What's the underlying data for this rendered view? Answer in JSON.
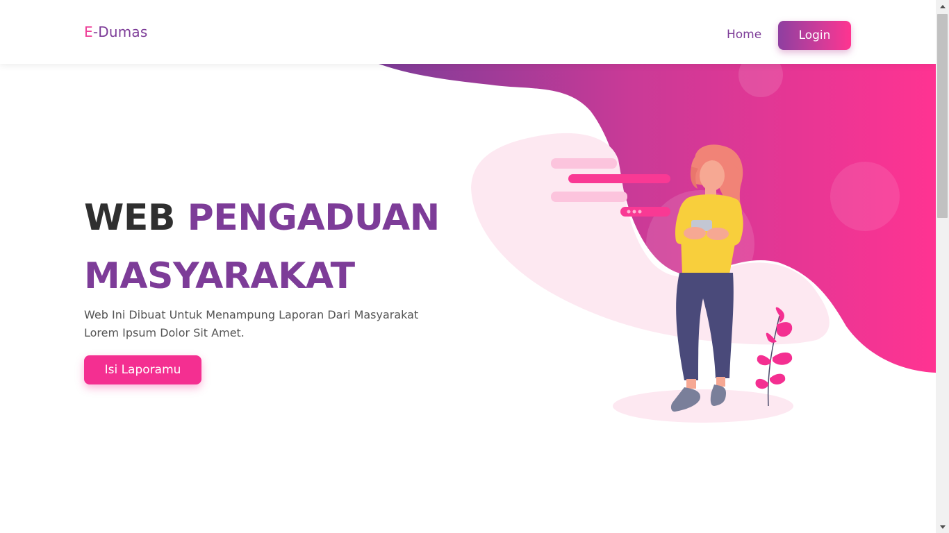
{
  "navbar": {
    "brand_prefix": "E",
    "brand_rest": "-Dumas",
    "home_label": "Home",
    "login_label": "Login"
  },
  "hero": {
    "title_word1": "WEB",
    "title_word2": "PENGADUAN",
    "title_line2": "MASYARAKAT",
    "desc_line1": "Web Ini Dibuat Untuk Menampung Laporan Dari Masyarakat",
    "desc_line2": "Lorem Ipsum Dolor Sit Amet.",
    "cta_label": "Isi Laporamu"
  },
  "colors": {
    "brand_purple": "#7d3c98",
    "brand_pink": "#f42f91",
    "gradient_start": "#8e3fa0",
    "gradient_end": "#ff3490"
  },
  "icons": {
    "illustration": "woman-with-phone-illustration",
    "plant": "plant-icon",
    "chat": "chat-bubble-icon"
  }
}
